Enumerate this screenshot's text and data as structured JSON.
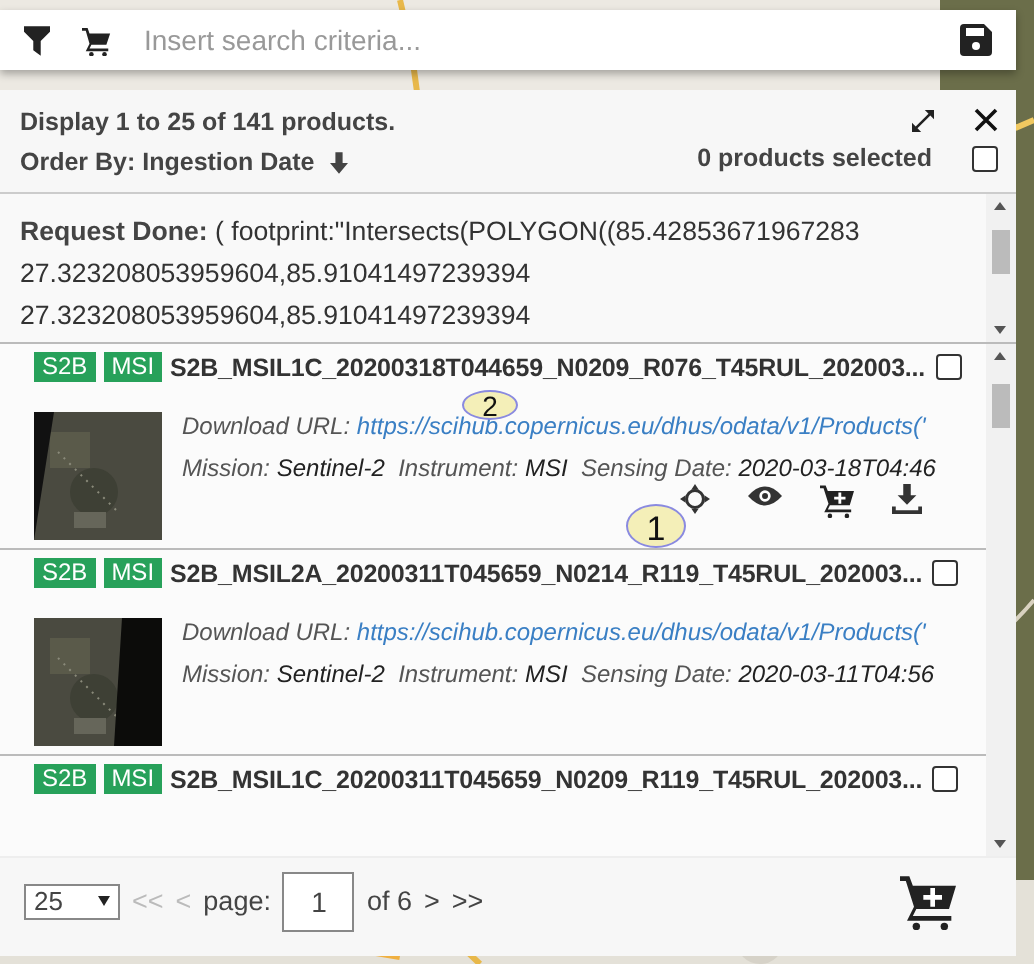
{
  "search_bar": {
    "placeholder": "Insert search criteria..."
  },
  "header": {
    "summary": "Display 1 to 25 of 141 products.",
    "order_by": "Order By: Ingestion Date",
    "selected_count": "0 products selected",
    "select_all_checked": false
  },
  "request": {
    "text": "**Request Done:** ( footprint:\"Intersects(POLYGON((85.42853671967283 27.323208053959604,85.91041497239394 27.323208053959604,85.91041497239394"
  },
  "products": [
    {
      "badges": [
        "S2B",
        "MSI"
      ],
      "title": "S2B_MSIL1C_20200318T044659_N0209_R076_T45RUL_202003...",
      "selected": false,
      "url_label": "Download URL:",
      "url": "https://scihub.copernicus.eu/dhus/odata/v1/Products('",
      "mission_label": "Mission:",
      "mission": "Sentinel-2",
      "instrument_label": "Instrument:",
      "instrument": "MSI",
      "date_label": "Sensing Date:",
      "date": "2020-03-18T04:46",
      "actions": [
        {
          "kind": "zoom"
        },
        {
          "kind": "view"
        },
        {
          "kind": "cart"
        },
        {
          "kind": "download"
        }
      ]
    },
    {
      "badges": [
        "S2B",
        "MSI"
      ],
      "title": "S2B_MSIL2A_20200311T045659_N0214_R119_T45RUL_202003...",
      "selected": false,
      "url_label": "Download URL:",
      "url": "https://scihub.copernicus.eu/dhus/odata/v1/Products('",
      "mission_label": "Mission:",
      "mission": "Sentinel-2",
      "instrument_label": "Instrument:",
      "instrument": "MSI",
      "date_label": "Sensing Date:",
      "date": "2020-03-11T04:56"
    },
    {
      "badges": [
        "S2B",
        "MSI"
      ],
      "title": "S2B_MSIL1C_20200311T045659_N0209_R119_T45RUL_202003...",
      "selected": false
    }
  ],
  "annotations": [
    {
      "label": "2"
    },
    {
      "label": "1"
    }
  ],
  "pager": {
    "page_size": "25",
    "first": "<<",
    "prev": "<",
    "page_label": "page:",
    "page": "1",
    "of": "of 6",
    "next": ">",
    "last": ">>"
  }
}
